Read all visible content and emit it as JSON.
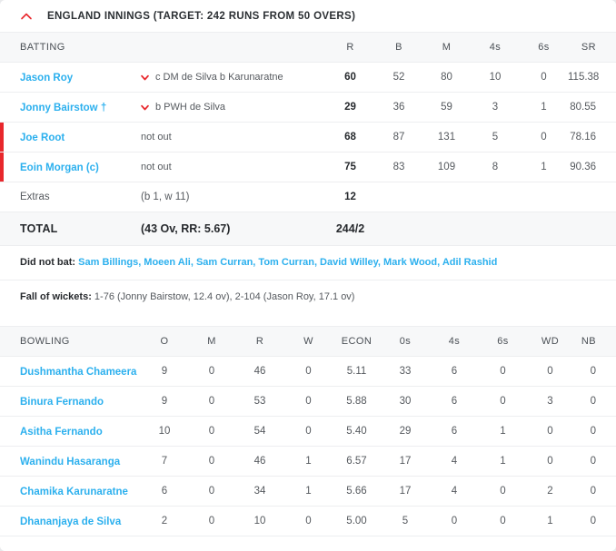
{
  "innings": {
    "collapse_icon": "chevron-up-icon",
    "title": "ENGLAND INNINGS (TARGET: 242 RUNS FROM 50 OVERS)"
  },
  "batting": {
    "headers": {
      "name": "BATTING",
      "dismissal": "",
      "r": "R",
      "b": "B",
      "m": "M",
      "fours": "4s",
      "sixes": "6s",
      "sr": "SR"
    },
    "rows": [
      {
        "name": "Jason Roy",
        "dismissal": "c DM de Silva b Karunaratne",
        "has_dismissal_icon": true,
        "not_out": false,
        "r": "60",
        "b": "52",
        "m": "80",
        "fours": "10",
        "sixes": "0",
        "sr": "115.38"
      },
      {
        "name": "Jonny Bairstow †",
        "dismissal": "b PWH de Silva",
        "has_dismissal_icon": true,
        "not_out": false,
        "r": "29",
        "b": "36",
        "m": "59",
        "fours": "3",
        "sixes": "1",
        "sr": "80.55"
      },
      {
        "name": "Joe Root",
        "dismissal": "not out",
        "has_dismissal_icon": false,
        "not_out": true,
        "r": "68",
        "b": "87",
        "m": "131",
        "fours": "5",
        "sixes": "0",
        "sr": "78.16"
      },
      {
        "name": "Eoin Morgan (c)",
        "dismissal": "not out",
        "has_dismissal_icon": false,
        "not_out": true,
        "r": "75",
        "b": "83",
        "m": "109",
        "fours": "8",
        "sixes": "1",
        "sr": "90.36"
      }
    ],
    "extras": {
      "label": "Extras",
      "detail": "(b 1, w 11)",
      "value": "12"
    },
    "total": {
      "label": "TOTAL",
      "detail": "(43 Ov, RR: 5.67)",
      "score": "244/2"
    }
  },
  "notes": {
    "did_not_bat_label": "Did not bat:",
    "did_not_bat_players": "Sam Billings, Moeen Ali, Sam Curran, Tom Curran, David Willey, Mark Wood, Adil Rashid",
    "fall_of_wickets_label": "Fall of wickets:",
    "fall_of_wickets_value": "1-76 (Jonny Bairstow, 12.4 ov), 2-104 (Jason Roy, 17.1 ov)"
  },
  "bowling": {
    "headers": {
      "name": "BOWLING",
      "o": "O",
      "m": "M",
      "r": "R",
      "w": "W",
      "econ": "ECON",
      "dots": "0s",
      "fours": "4s",
      "sixes": "6s",
      "wd": "WD",
      "nb": "NB"
    },
    "rows": [
      {
        "name": "Dushmantha Chameera",
        "o": "9",
        "m": "0",
        "r": "46",
        "w": "0",
        "econ": "5.11",
        "dots": "33",
        "fours": "6",
        "sixes": "0",
        "wd": "0",
        "nb": "0"
      },
      {
        "name": "Binura Fernando",
        "o": "9",
        "m": "0",
        "r": "53",
        "w": "0",
        "econ": "5.88",
        "dots": "30",
        "fours": "6",
        "sixes": "0",
        "wd": "3",
        "nb": "0"
      },
      {
        "name": "Asitha Fernando",
        "o": "10",
        "m": "0",
        "r": "54",
        "w": "0",
        "econ": "5.40",
        "dots": "29",
        "fours": "6",
        "sixes": "1",
        "wd": "0",
        "nb": "0"
      },
      {
        "name": "Wanindu Hasaranga",
        "o": "7",
        "m": "0",
        "r": "46",
        "w": "1",
        "econ": "6.57",
        "dots": "17",
        "fours": "4",
        "sixes": "1",
        "wd": "0",
        "nb": "0"
      },
      {
        "name": "Chamika Karunaratne",
        "o": "6",
        "m": "0",
        "r": "34",
        "w": "1",
        "econ": "5.66",
        "dots": "17",
        "fours": "4",
        "sixes": "0",
        "wd": "2",
        "nb": "0"
      },
      {
        "name": "Dhananjaya de Silva",
        "o": "2",
        "m": "0",
        "r": "10",
        "w": "0",
        "econ": "5.00",
        "dots": "5",
        "fours": "0",
        "sixes": "0",
        "wd": "1",
        "nb": "0"
      }
    ]
  },
  "colors": {
    "link_blue": "#2cb0ee",
    "accent_red": "#e8272c",
    "header_bg": "#f7f8f9",
    "text_dark": "#26292d"
  }
}
